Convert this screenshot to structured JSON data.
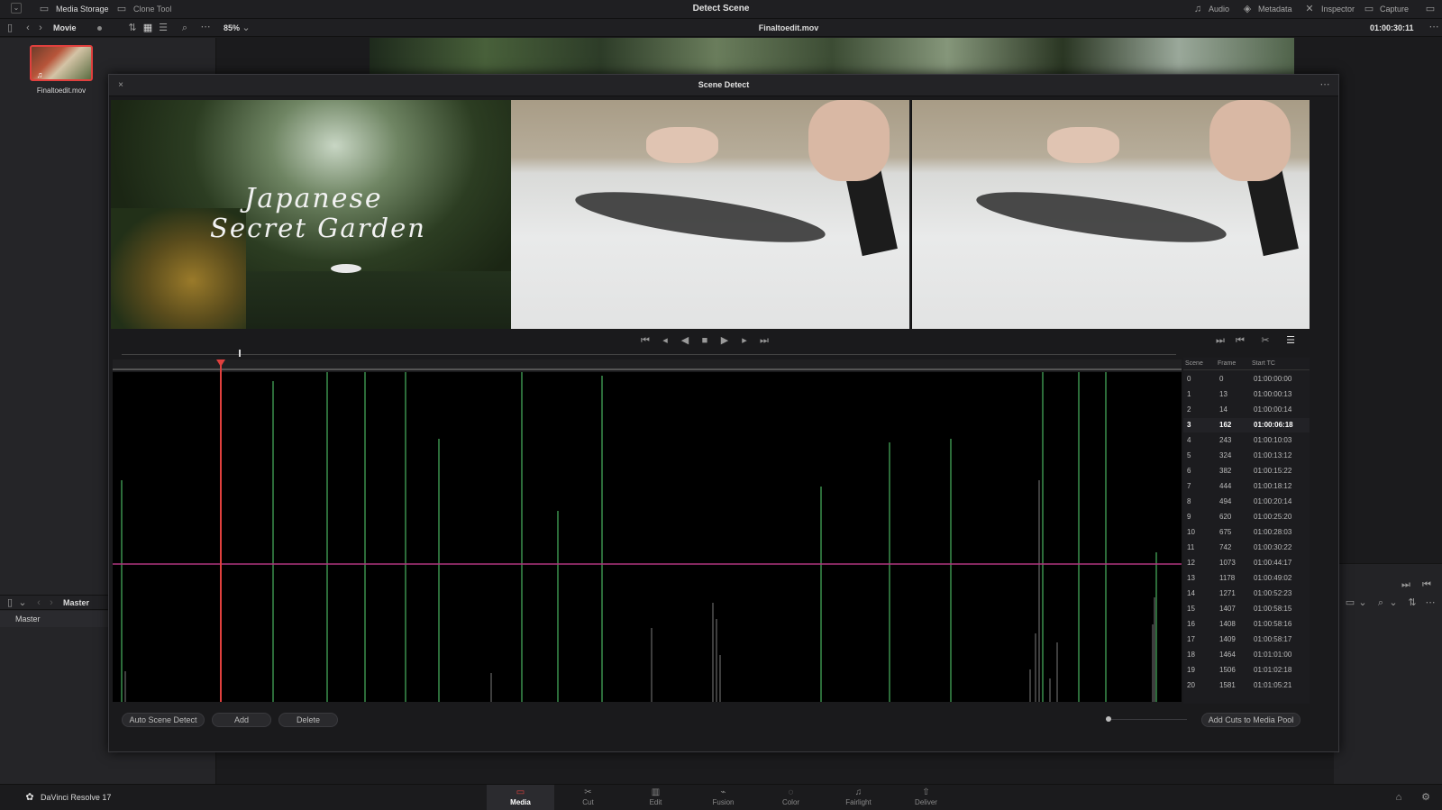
{
  "app_title": "Detect Scene",
  "top_tabs": {
    "media_storage": "Media Storage",
    "clone_tool": "Clone Tool"
  },
  "top_right": {
    "audio": "Audio",
    "metadata": "Metadata",
    "inspector": "Inspector",
    "capture": "Capture"
  },
  "toolbar": {
    "bin_name": "Movie",
    "zoom": "85%",
    "file_name": "Finaltoedit.mov",
    "timecode": "01:00:30:11"
  },
  "media_pool": {
    "clip_name": "Finaltoedit.mov",
    "master_header": "Master",
    "master_item": "Master"
  },
  "dialog": {
    "title": "Scene Detect",
    "overlay_title_line1": "Japanese",
    "overlay_title_line2": "Secret Garden",
    "buttons": {
      "auto_detect": "Auto Scene Detect",
      "add": "Add",
      "delete": "Delete",
      "add_cuts": "Add Cuts to Media Pool"
    },
    "table_headers": {
      "scene": "Scene",
      "frame": "Frame",
      "start_tc": "Start TC"
    },
    "selected_scene_index": 3,
    "scenes": [
      {
        "scene": "0",
        "frame": "0",
        "tc": "01:00:00:00"
      },
      {
        "scene": "1",
        "frame": "13",
        "tc": "01:00:00:13"
      },
      {
        "scene": "2",
        "frame": "14",
        "tc": "01:00:00:14"
      },
      {
        "scene": "3",
        "frame": "162",
        "tc": "01:00:06:18"
      },
      {
        "scene": "4",
        "frame": "243",
        "tc": "01:00:10:03"
      },
      {
        "scene": "5",
        "frame": "324",
        "tc": "01:00:13:12"
      },
      {
        "scene": "6",
        "frame": "382",
        "tc": "01:00:15:22"
      },
      {
        "scene": "7",
        "frame": "444",
        "tc": "01:00:18:12"
      },
      {
        "scene": "8",
        "frame": "494",
        "tc": "01:00:20:14"
      },
      {
        "scene": "9",
        "frame": "620",
        "tc": "01:00:25:20"
      },
      {
        "scene": "10",
        "frame": "675",
        "tc": "01:00:28:03"
      },
      {
        "scene": "11",
        "frame": "742",
        "tc": "01:00:30:22"
      },
      {
        "scene": "12",
        "frame": "1073",
        "tc": "01:00:44:17"
      },
      {
        "scene": "13",
        "frame": "1178",
        "tc": "01:00:49:02"
      },
      {
        "scene": "14",
        "frame": "1271",
        "tc": "01:00:52:23"
      },
      {
        "scene": "15",
        "frame": "1407",
        "tc": "01:00:58:15"
      },
      {
        "scene": "16",
        "frame": "1408",
        "tc": "01:00:58:16"
      },
      {
        "scene": "17",
        "frame": "1409",
        "tc": "01:00:58:17"
      },
      {
        "scene": "18",
        "frame": "1464",
        "tc": "01:01:01:00"
      },
      {
        "scene": "19",
        "frame": "1506",
        "tc": "01:01:02:18"
      },
      {
        "scene": "20",
        "frame": "1581",
        "tc": "01:01:05:21"
      }
    ]
  },
  "bottom": {
    "brand": "DaVinci Resolve 17",
    "pages": [
      "Media",
      "Cut",
      "Edit",
      "Fusion",
      "Color",
      "Fairlight",
      "Deliver"
    ],
    "active_page": "Media"
  },
  "colors": {
    "accent_red": "#e0403e",
    "threshold_line": "#b0357f",
    "peak_green": "#3f9a52"
  }
}
